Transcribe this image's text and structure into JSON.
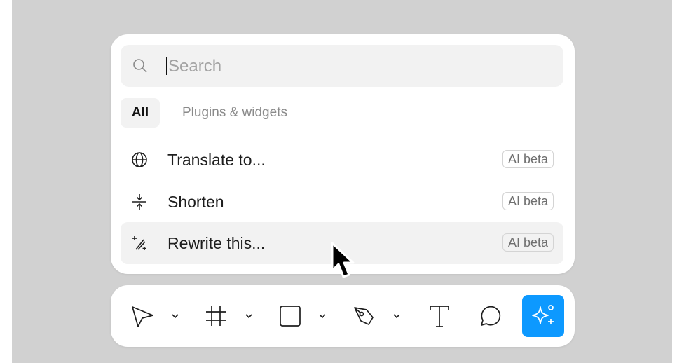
{
  "search": {
    "placeholder": "Search"
  },
  "tabs": [
    {
      "label": "All"
    },
    {
      "label": "Plugins & widgets"
    }
  ],
  "items": [
    {
      "label": "Translate to...",
      "badge": "AI beta",
      "icon": "globe-icon"
    },
    {
      "label": "Shorten",
      "badge": "AI beta",
      "icon": "shorten-icon"
    },
    {
      "label": "Rewrite this...",
      "badge": "AI beta",
      "icon": "magic-wand-icon"
    }
  ],
  "toolbar": {
    "tools": [
      "move-icon",
      "frame-icon",
      "rectangle-icon",
      "pen-icon",
      "text-icon",
      "comment-icon",
      "ai-actions-icon"
    ],
    "active_color": "#0d99ff"
  }
}
